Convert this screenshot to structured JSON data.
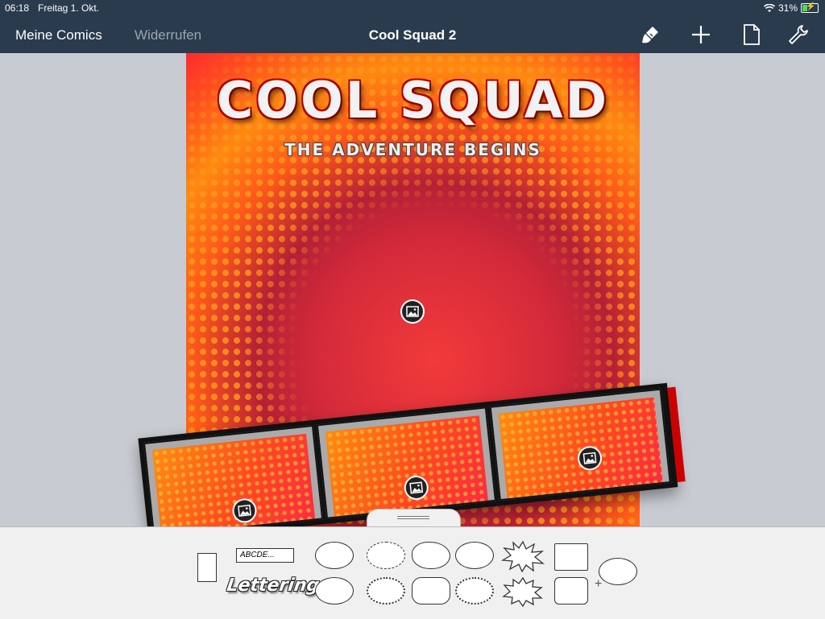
{
  "status": {
    "time": "06:18",
    "date": "Freitag 1. Okt.",
    "battery": "31%",
    "battery_level": 0.31
  },
  "nav": {
    "back_label": "Meine Comics",
    "undo_label": "Widerrufen",
    "title": "Cool Squad 2"
  },
  "cover": {
    "title": "COOL SQUAD",
    "subtitle": "The Adventure Begins"
  },
  "tools": {
    "caption_text": "ABCDE...",
    "lettering_text": "Lettering"
  },
  "colors": {
    "nav_bg": "#2a3b4d",
    "accent_red": "#d42a3a",
    "accent_orange": "#ff8a10"
  }
}
